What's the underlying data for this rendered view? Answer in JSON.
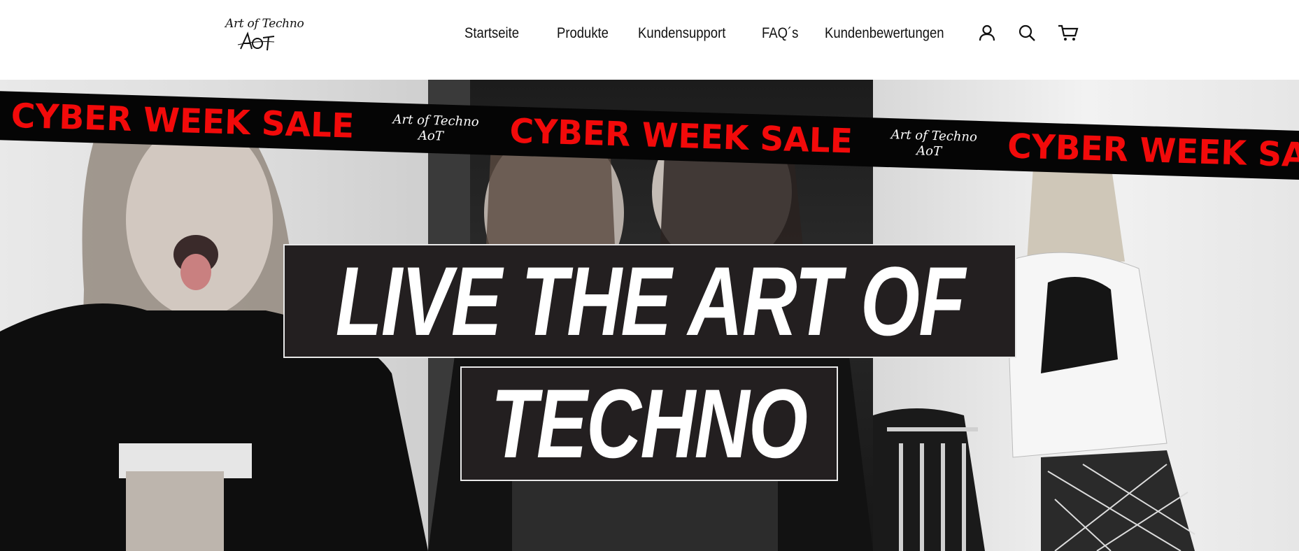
{
  "brand": {
    "logo_text": "Art of Techno",
    "logo_mark": "AoT"
  },
  "nav": {
    "items": [
      "Startseite",
      "Produkte",
      "Kundensupport",
      "FAQ´s",
      "Kundenbewertungen"
    ]
  },
  "header_icons": [
    "account-icon",
    "search-icon",
    "cart-icon"
  ],
  "hero": {
    "ribbon_text": "CYBER WEEK SALE",
    "ribbon_color": "#f20a0a",
    "headline_line1": "LIVE THE ART OF",
    "headline_line2": "TECHNO"
  }
}
